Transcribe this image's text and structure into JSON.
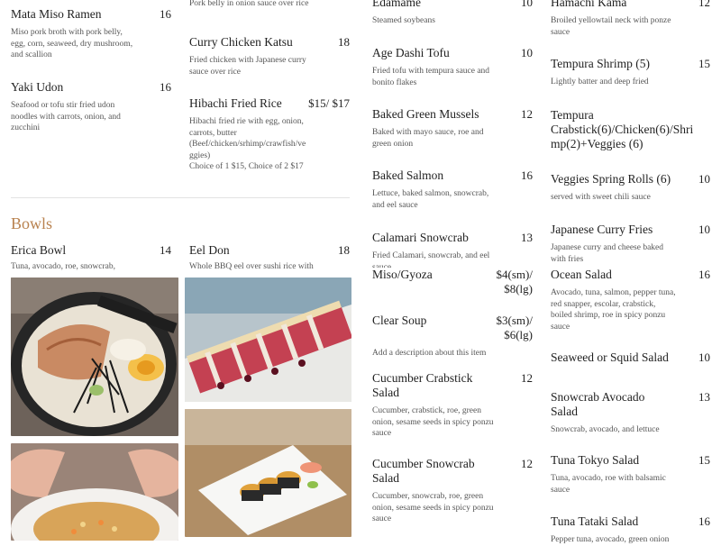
{
  "col1": {
    "items": [
      {
        "name": "Mata Miso Ramen",
        "price": "16",
        "desc": "Miso pork broth with pork belly,\negg, corn, seaweed, dry mushroom,\nand scallion"
      },
      {
        "name": "Yaki Udon",
        "price": "16",
        "desc": "Seafood or tofu stir fried udon\nnoodles with carrots, onion, and\nzucchini"
      }
    ]
  },
  "col2": {
    "top_desc": "Pork belly in onion sauce over rice",
    "items": [
      {
        "name": "Curry Chicken Katsu",
        "price": "18",
        "desc": "Fried chicken with Japanese curry\nsauce over rice"
      },
      {
        "name": "Hibachi Fried Rice",
        "price": "$15/ $17",
        "desc": "Hibachi fried rie with egg, onion,\ncarrots, butter\n(Beef/chicken/srhimp/crawfish/ve\nggies)\nChoice of 1  $15,  Choice of 2  $17"
      }
    ]
  },
  "bowls": {
    "heading": "Bowls",
    "items": [
      {
        "name": "Erica Bowl",
        "price": "14",
        "desc": "Tuna, avocado, roe, snowcrab,"
      },
      {
        "name": "Eel Don",
        "price": "18",
        "desc": "Whole BBQ eel over sushi rice with"
      }
    ]
  },
  "col3": {
    "items": [
      {
        "name": "Edamame",
        "price": "10",
        "desc": "Steamed soybeans"
      },
      {
        "name": "Age Dashi Tofu",
        "price": "10",
        "desc": "Fried tofu with tempura sauce and\nbonito flakes"
      },
      {
        "name": "Baked Green Mussels",
        "price": "12",
        "desc": "Baked with mayo sauce, roe and\ngreen onion"
      },
      {
        "name": "Baked Salmon",
        "price": "16",
        "desc": "Lettuce, baked salmon, snowcrab,\nand eel sauce"
      },
      {
        "name": "Calamari Snowcrab",
        "price": "13",
        "desc": "Fried Calamari, snowcrab, and eel\nsauce"
      },
      {
        "name": "Miso/Gyoza",
        "price": "$4(sm)/\n$8(lg)",
        "desc": ""
      },
      {
        "name": "Clear Soup",
        "price": "$3(sm)/\n$6(lg)",
        "desc": "Add a description about this item"
      },
      {
        "name": "Cucumber Crabstick\nSalad",
        "price": "12",
        "desc": "Cucumber, crabstick, roe, green\nonion, sesame seeds in spicy ponzu\nsauce"
      },
      {
        "name": "Cucumber Snowcrab\nSalad",
        "price": "12",
        "desc": "Cucumber, snowcrab, roe, green\nonion, sesame seeds in spicy ponzu\nsauce"
      }
    ]
  },
  "col4": {
    "items": [
      {
        "name": "Hamachi Kama",
        "price": "12",
        "desc": "Broiled yellowtail neck with ponze\nsauce"
      },
      {
        "name": "Tempura Shrimp (5)",
        "price": "15",
        "desc": "Lightly batter and deep fried"
      },
      {
        "name": "Tempura\nCrabstick(6)/Chicken(6)/Shri\nmp(2)+Veggies (6)",
        "price": "",
        "desc": ""
      },
      {
        "name": "Veggies Spring Rolls (6)",
        "price": "10",
        "desc": "served with sweet chili sauce"
      },
      {
        "name": "Japanese Curry Fries",
        "price": "10",
        "desc": "Japanese curry and cheese baked\nwith fries"
      },
      {
        "name": "Ocean Salad",
        "price": "16",
        "desc": "Avocado, tuna, salmon, pepper tuna,\nred snapper, escolar, crabstick,\nboiled shrimp, roe in spicy ponzu\nsauce"
      },
      {
        "name": "Seaweed or Squid Salad",
        "price": "10",
        "desc": ""
      },
      {
        "name": "Snowcrab Avocado\nSalad",
        "price": "13",
        "desc": "Snowcrab, avocado, and lettuce"
      },
      {
        "name": "Tuna Tokyo Salad",
        "price": "15",
        "desc": "Tuna, avocado, roe with balsamic\nsauce"
      },
      {
        "name": "Tuna Tataki Salad",
        "price": "16",
        "desc": "Pepper tuna, avocado, green onion"
      }
    ]
  },
  "colors": {
    "heading": "#b9824f",
    "text": "#1f1f1f",
    "desc": "#555555"
  }
}
